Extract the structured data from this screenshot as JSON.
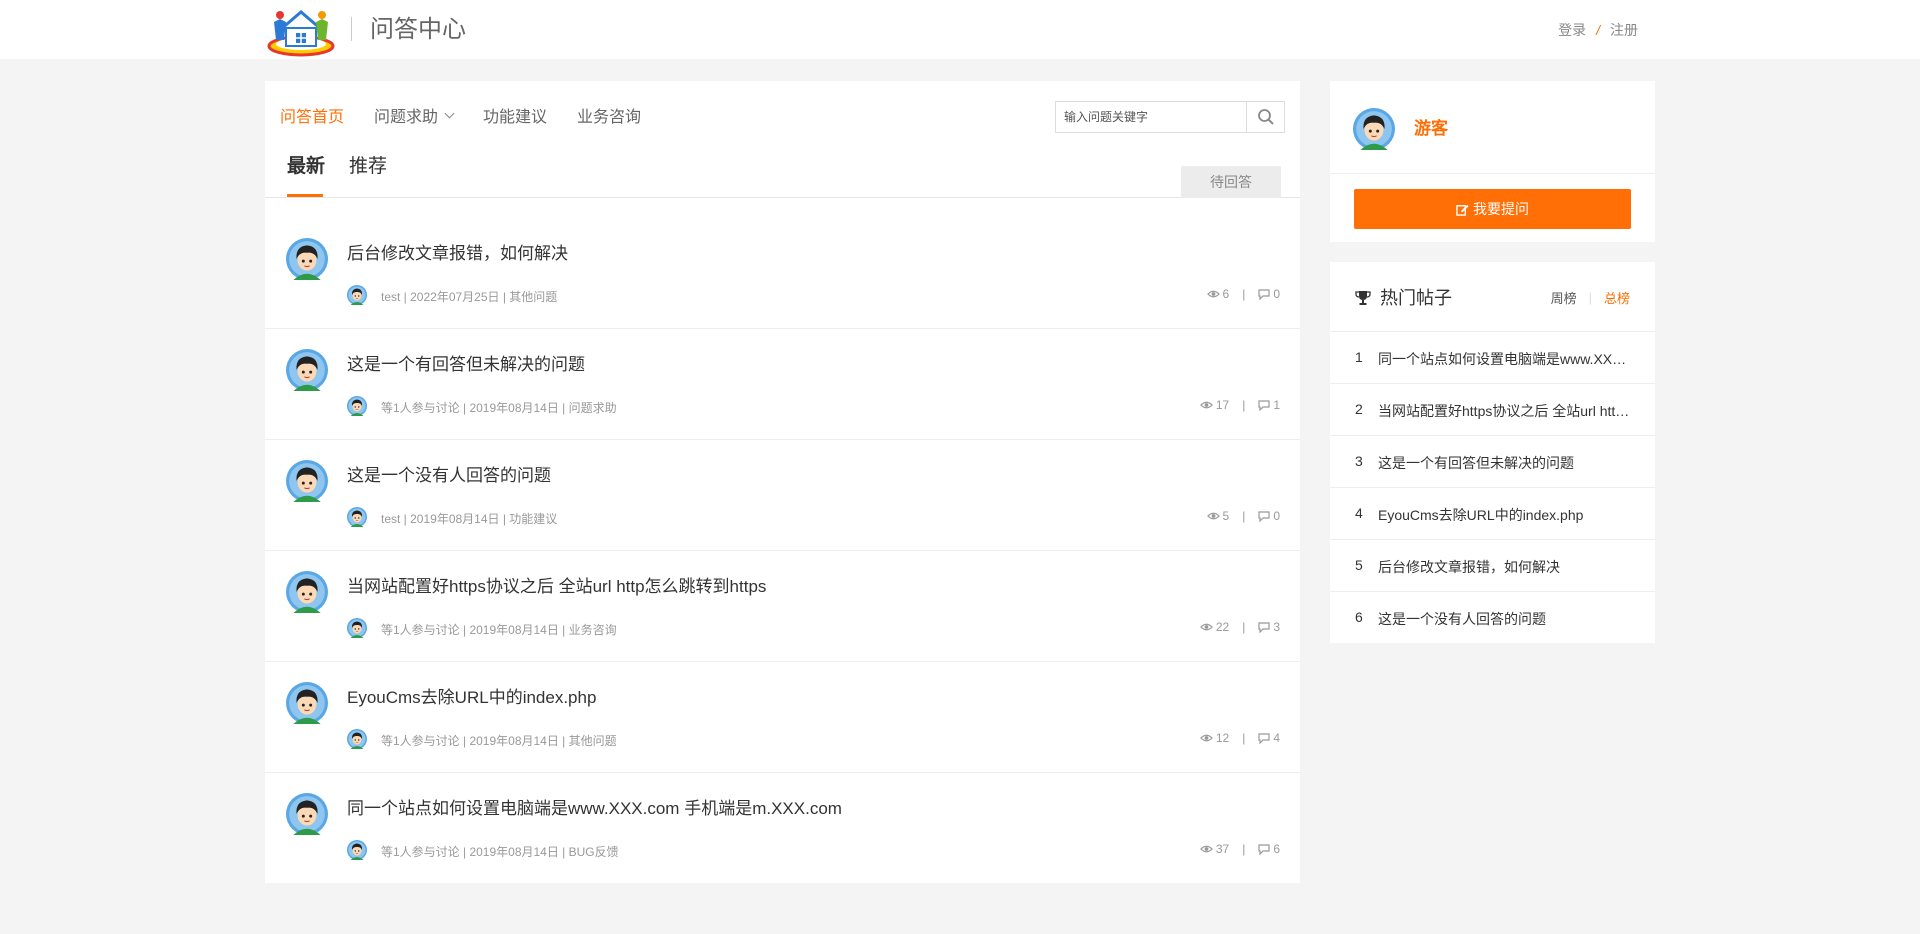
{
  "header": {
    "site_title": "问答中心",
    "login_label": "登录",
    "separator": "/",
    "register_label": "注册"
  },
  "nav": {
    "items": [
      {
        "label": "问答首页"
      },
      {
        "label": "问题求助"
      },
      {
        "label": "功能建议"
      },
      {
        "label": "业务咨询"
      }
    ]
  },
  "search": {
    "placeholder": "输入问题关键字"
  },
  "tabs": {
    "latest": "最新",
    "recommended": "推荐",
    "pending": "待回答"
  },
  "questions": [
    {
      "title": "后台修改文章报错，如何解决",
      "meta": "test | 2022年07月25日 | 其他问题",
      "views": "6",
      "replies": "0"
    },
    {
      "title": "这是一个有回答但未解决的问题",
      "meta": "等1人参与讨论 | 2019年08月14日 | 问题求助",
      "views": "17",
      "replies": "1"
    },
    {
      "title": "这是一个没有人回答的问题",
      "meta": "test | 2019年08月14日 | 功能建议",
      "views": "5",
      "replies": "0"
    },
    {
      "title": "当网站配置好https协议之后 全站url http怎么跳转到https",
      "meta": "等1人参与讨论 | 2019年08月14日 | 业务咨询",
      "views": "22",
      "replies": "3"
    },
    {
      "title": "EyouCms去除URL中的index.php",
      "meta": "等1人参与讨论 | 2019年08月14日 | 其他问题",
      "views": "12",
      "replies": "4"
    },
    {
      "title": "同一个站点如何设置电脑端是www.XXX.com 手机端是m.XXX.com",
      "meta": "等1人参与讨论 | 2019年08月14日 | BUG反馈",
      "views": "37",
      "replies": "6"
    }
  ],
  "stat_separator": "|",
  "user": {
    "name": "游客",
    "ask_label": "我要提问"
  },
  "hot": {
    "title": "热门帖子",
    "weekly": "周榜",
    "total": "总榜",
    "items": [
      {
        "num": "1",
        "text": "同一个站点如何设置电脑端是www.XXX.com 手机端是m.XXX.com"
      },
      {
        "num": "2",
        "text": "当网站配置好https协议之后 全站url http怎么跳转到https"
      },
      {
        "num": "3",
        "text": "这是一个有回答但未解决的问题"
      },
      {
        "num": "4",
        "text": "EyouCms去除URL中的index.php"
      },
      {
        "num": "5",
        "text": "后台修改文章报错，如何解决"
      },
      {
        "num": "6",
        "text": "这是一个没有人回答的问题"
      }
    ]
  },
  "colors": {
    "accent": "#ff6f06",
    "background": "#f4f4f4"
  }
}
